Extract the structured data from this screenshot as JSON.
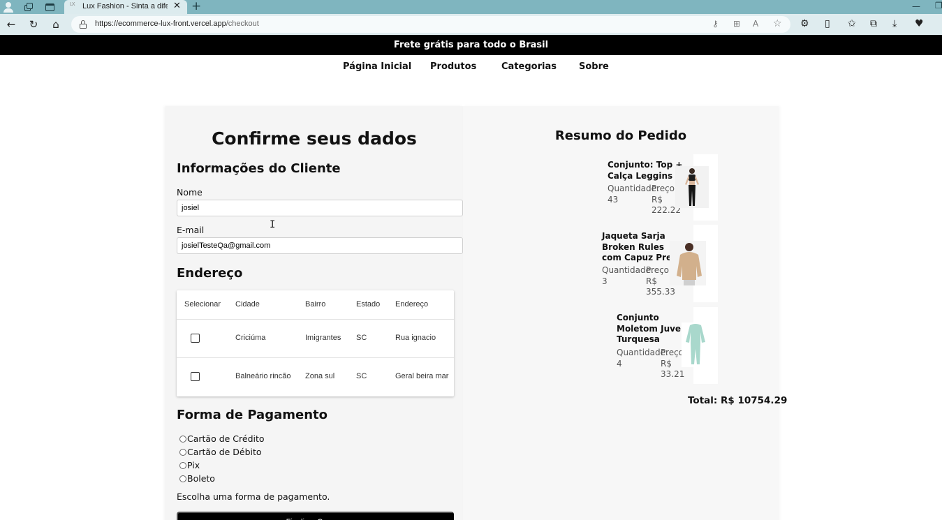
{
  "browser": {
    "tab_title": "Lux Fashion - Sinta a diferença d",
    "tab_favicon": "LX",
    "url_host": "https://ecommerce-lux-front.vercel.app",
    "url_path": "/checkout"
  },
  "promo": {
    "text": "Frete grátis para todo o Brasil"
  },
  "nav": {
    "items": [
      {
        "label": "Página Inicial"
      },
      {
        "label": "Produtos"
      },
      {
        "label": "Categorias"
      },
      {
        "label": "Sobre"
      }
    ]
  },
  "checkout": {
    "title": "Confirme seus dados",
    "client_heading": "Informações do Cliente",
    "name_label": "Nome",
    "name_value": "josiel",
    "email_label": "E-mail",
    "email_value": "josielTesteQa@gmail.com",
    "address_heading": "Endereço",
    "address_table": {
      "headers": [
        "Selecionar",
        "Cidade",
        "Bairro",
        "Estado",
        "Endereço"
      ],
      "rows": [
        {
          "cidade": "Criciúma",
          "bairro": "Imigrantes",
          "estado": "SC",
          "endereco": "Rua ignacio",
          "selected": false
        },
        {
          "cidade": "Balneário rincão",
          "bairro": "Zona sul",
          "estado": "SC",
          "endereco": "Geral beira mar",
          "selected": false
        }
      ]
    },
    "payment_heading": "Forma de Pagamento",
    "payment_options": [
      {
        "label": "Cartão de Crédito",
        "selected": false
      },
      {
        "label": "Cartão de Débito",
        "selected": false
      },
      {
        "label": "Pix",
        "selected": false
      },
      {
        "label": "Boleto",
        "selected": false
      }
    ],
    "payment_hint": "Escolha uma forma de pagamento.",
    "finalize_label": "Finalizar Compra"
  },
  "summary": {
    "title": "Resumo do Pedido",
    "quantity_label": "Quantidade:",
    "price_label": "Preço:",
    "items": [
      {
        "name_lines": [
          "Conjunto: Top +",
          "Calça Leggins"
        ],
        "quantity": "43",
        "price_lines": [
          "R$",
          "222.22"
        ]
      },
      {
        "name_lines": [
          "Jaqueta Sarja",
          "Broken Rules",
          "com Capuz Preta"
        ],
        "quantity": "3",
        "price_lines": [
          "R$",
          "355.33"
        ]
      },
      {
        "name_lines": [
          "Conjunto",
          "Moletom Juvenil",
          "Turquesa"
        ],
        "quantity": "4",
        "price_lines": [
          "R$",
          "33.21"
        ]
      }
    ],
    "total_text": "Total: R$ 10754.29"
  },
  "colors": {
    "chrome_tab": "#7fb5bf",
    "chrome_bar": "#dfecef",
    "promo_bg": "#000000",
    "card_bg": "#f5f5f5"
  }
}
